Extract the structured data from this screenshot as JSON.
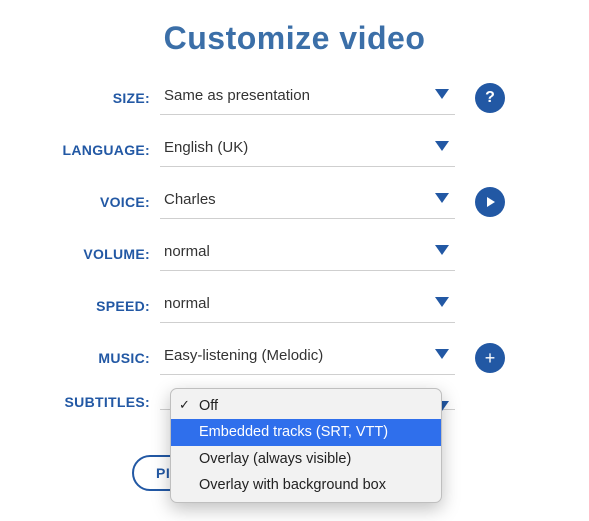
{
  "title": "Customize video",
  "rows": {
    "size": {
      "label": "SIZE:",
      "value": "Same as presentation"
    },
    "language": {
      "label": "LANGUAGE:",
      "value": "English (UK)"
    },
    "voice": {
      "label": "VOICE:",
      "value": "Charles"
    },
    "volume": {
      "label": "VOLUME:",
      "value": "normal"
    },
    "speed": {
      "label": "SPEED:",
      "value": "normal"
    },
    "music": {
      "label": "MUSIC:",
      "value": "Easy-listening (Melodic)"
    },
    "subtitles": {
      "label": "SUBTITLES:",
      "value": ""
    }
  },
  "helpGlyph": "?",
  "plusGlyph": "+",
  "subtitlesOptions": {
    "off": "Off",
    "embedded": "Embedded tracks (SRT, VTT)",
    "overlay": "Overlay (always visible)",
    "overlayBox": "Overlay with background box"
  },
  "checkmark": "✓",
  "previewLabel": "PI"
}
